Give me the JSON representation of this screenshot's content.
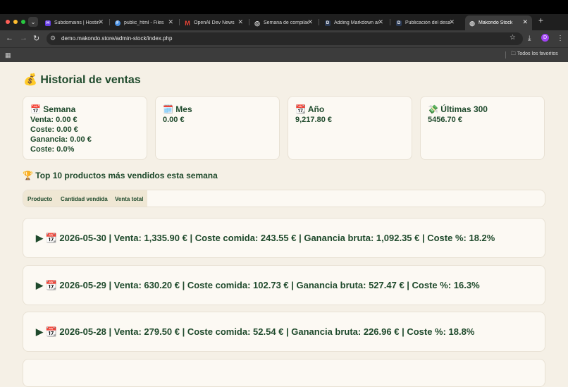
{
  "browser": {
    "tabs": [
      {
        "title": "Subdomains | Hostinger",
        "favicon": "hostinger-icon",
        "color": "#673de6",
        "glyph": "H"
      },
      {
        "title": "public_html - Files",
        "favicon": "files-icon",
        "color": "#4a90e2",
        "glyph": "F"
      },
      {
        "title": "OpenAI Dev News",
        "favicon": "gmail-icon",
        "color": "#ea4335",
        "glyph": "M"
      },
      {
        "title": "Semana de compilación",
        "favicon": "openai-icon",
        "color": "#555555",
        "glyph": "◎"
      },
      {
        "title": "Adding Markdown and",
        "favicon": "d-icon",
        "color": "#2b3a55",
        "glyph": "D"
      },
      {
        "title": "Publicación del desarrollo",
        "favicon": "d-icon",
        "color": "#2b3a55",
        "glyph": "D"
      },
      {
        "title": "Makondo Stock",
        "favicon": "globe-icon",
        "color": "#777777",
        "glyph": "◍"
      }
    ],
    "url": "demo.makondo.store/admin-stock/index.php",
    "avatar_letter": "D",
    "bookmarks_all": "Todos los favoritos"
  },
  "page": {
    "title": "💰 Historial de ventas",
    "cards": [
      {
        "title": "📅 Semana",
        "lines": [
          "Venta: 0.00 €",
          "Coste: 0.00 €",
          "Ganancia: 0.00 €",
          "Coste: 0.0%"
        ]
      },
      {
        "title": "🗓️ Mes",
        "lines": [
          "0.00 €"
        ]
      },
      {
        "title": "📆 Año",
        "lines": [
          "9,217.80 €"
        ]
      },
      {
        "title": "💸 Últimas 300",
        "lines": [
          "5456.70 €"
        ]
      }
    ],
    "top_title": "🏆 Top 10 productos más vendidos esta semana",
    "table_headers": [
      "Producto",
      "Cantidad vendida",
      "Venta total"
    ],
    "days": [
      "▶ 📆 2026-05-30 | Venta: 1,335.90 € | Coste comida: 243.55 € | Ganancia bruta: 1,092.35 € | Coste %: 18.2%",
      "▶ 📆 2026-05-29 | Venta: 630.20 € | Coste comida: 102.73 € | Ganancia bruta: 527.47 € | Coste %: 16.3%",
      "▶ 📆 2026-05-28 | Venta: 279.50 € | Coste comida: 52.54 € | Ganancia bruta: 226.96 € | Coste %: 18.8%"
    ]
  }
}
